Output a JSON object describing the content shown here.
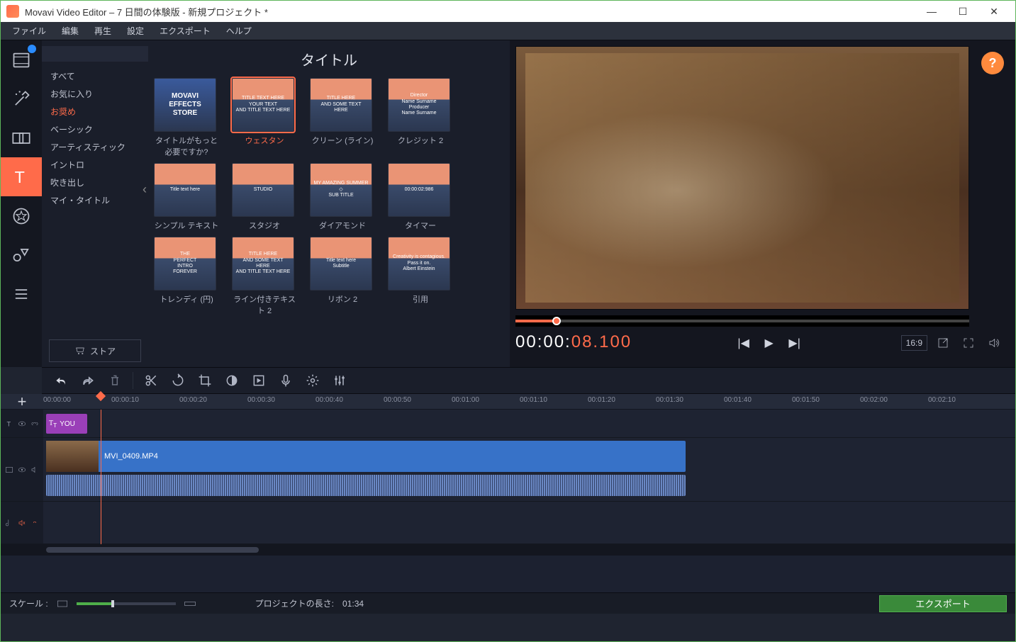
{
  "window": {
    "title": "Movavi Video Editor – 7 日間の体験版 - 新規プロジェクト *"
  },
  "menu": {
    "items": [
      "ファイル",
      "編集",
      "再生",
      "設定",
      "エクスポート",
      "ヘルプ"
    ]
  },
  "vtabs": [
    {
      "name": "import-tab",
      "icon": "film",
      "badge": true
    },
    {
      "name": "filters-tab",
      "icon": "wand"
    },
    {
      "name": "transitions-tab",
      "icon": "transition"
    },
    {
      "name": "titles-tab",
      "icon": "text",
      "active": true
    },
    {
      "name": "stickers-tab",
      "icon": "star"
    },
    {
      "name": "callouts-tab",
      "icon": "shapes"
    },
    {
      "name": "more-tab",
      "icon": "list"
    }
  ],
  "library": {
    "header": "タイトル",
    "search_placeholder": "",
    "categories": [
      "すべて",
      "お気に入り",
      "お奨め",
      "ベーシック",
      "アーティスティック",
      "イントロ",
      "吹き出し",
      "マイ・タイトル"
    ],
    "selected_category_index": 2,
    "store_label": "ストア",
    "items": [
      {
        "thumb_lines": [
          "MOVAVI",
          "EFFECTS",
          "STORE"
        ],
        "label": "タイトルがもっと必要ですか?",
        "store": true
      },
      {
        "thumb_lines": [
          "TITLE TEXT HERE",
          "YOUR TEXT",
          "AND TITLE TEXT HERE"
        ],
        "label": "ウェスタン",
        "selected": true
      },
      {
        "thumb_lines": [
          "TITLE HERE",
          "AND SOME TEXT HERE"
        ],
        "label": "クリーン (ライン)"
      },
      {
        "thumb_lines": [
          "Director",
          "Name Surname",
          "Producer",
          "Name Surname"
        ],
        "label": "クレジット 2"
      },
      {
        "thumb_lines": [
          "Title text here"
        ],
        "label": "シンプル テキスト"
      },
      {
        "thumb_lines": [
          "STUDIO"
        ],
        "label": "スタジオ"
      },
      {
        "thumb_lines": [
          "MY AMAZING SUMMER",
          "◇",
          "SUB TITLE"
        ],
        "label": "ダイアモンド"
      },
      {
        "thumb_lines": [
          "00:00:02:986"
        ],
        "label": "タイマー"
      },
      {
        "thumb_lines": [
          "THE",
          "PERFECT",
          "INTRO",
          "FOREVER"
        ],
        "label": "トレンディ (円)"
      },
      {
        "thumb_lines": [
          "TITLE HERE",
          "AND SOME TEXT HERE",
          "AND TITLE TEXT HERE"
        ],
        "label": "ライン付きテキスト 2"
      },
      {
        "thumb_lines": [
          "Title text here",
          "Subtitle"
        ],
        "label": "リボン 2"
      },
      {
        "thumb_lines": [
          "Creativity is contagious.",
          "Pass it on.",
          "Albert Einstein"
        ],
        "label": "引用"
      }
    ]
  },
  "preview": {
    "timecode_main": "00:00:",
    "timecode_ms": "08.100",
    "ratio_label": "16:9"
  },
  "timeline": {
    "ticks": [
      "00:00:00",
      "00:00:10",
      "00:00:20",
      "00:00:30",
      "00:00:40",
      "00:00:50",
      "00:01:00",
      "00:01:10",
      "00:01:20",
      "00:01:30",
      "00:01:40",
      "00:01:50",
      "00:02:00",
      "00:02:10"
    ],
    "title_clip_label": "YOU",
    "video_clip_label": "MVI_0409.MP4",
    "playhead_pct": 6.2
  },
  "status": {
    "scale_label": "スケール :",
    "length_label": "プロジェクトの長さ:",
    "length_value": "01:34",
    "export_label": "エクスポート"
  }
}
